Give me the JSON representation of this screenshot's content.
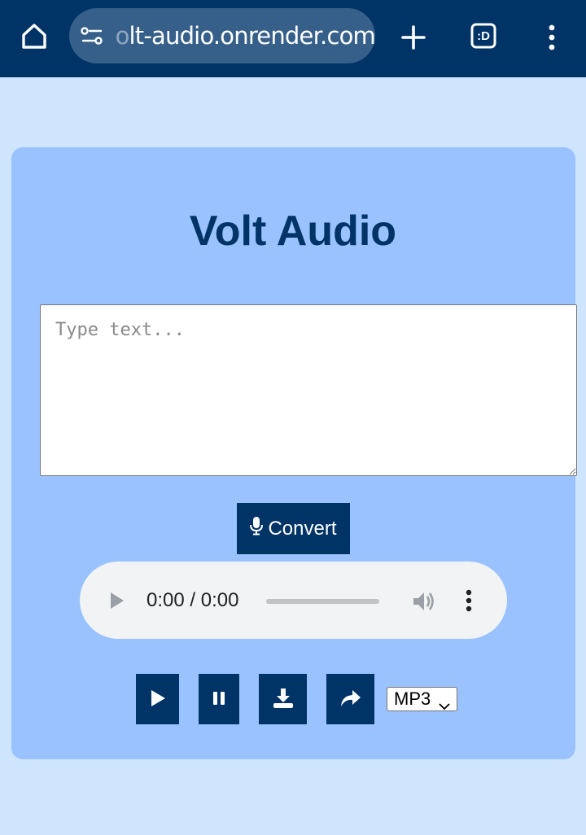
{
  "browser": {
    "url_faded_prefix": "o",
    "url_text": "lt-audio.onrender.com",
    "tab_count_label": ":D"
  },
  "app": {
    "title": "Volt Audio",
    "text_input": {
      "placeholder": "Type text...",
      "value": ""
    },
    "convert_button": {
      "label": "Convert",
      "icon": "microphone-icon"
    }
  },
  "audio_player": {
    "time_display": "0:00 / 0:00",
    "progress": 0
  },
  "controls": {
    "buttons": [
      "play-icon",
      "pause-icon",
      "download-icon",
      "share-icon"
    ],
    "format_select": {
      "selected": "MP3"
    }
  },
  "colors": {
    "chrome": "#003366",
    "page_background": "#cfe5fd",
    "card": "#99c2ff",
    "accent": "#003366"
  }
}
